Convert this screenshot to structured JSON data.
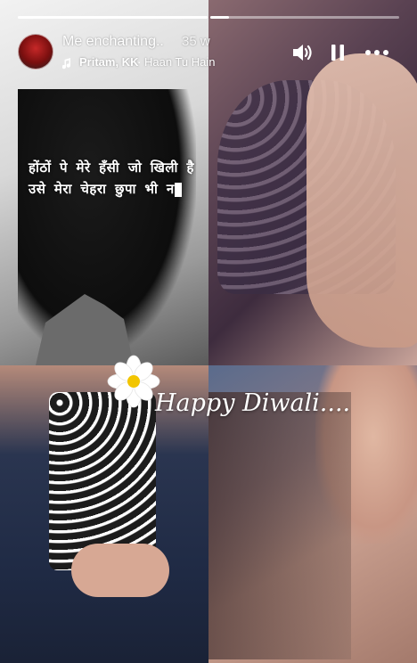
{
  "story": {
    "progress_segments": [
      1.0,
      0.1
    ],
    "account_title": "Me enchanting..",
    "time_ago": "35 w",
    "music": {
      "artist": "Pritam, KK",
      "separator": "·",
      "song": "Haan Tu Hain"
    },
    "controls": {
      "sound_icon": "speaker-icon",
      "pause_icon": "pause-icon",
      "more_icon": "more-icon"
    },
    "overlay_text_line1": "होंठों पे मेरे हँसी जो खिली है",
    "overlay_text_line2": "उसे मेरा चेहरा छुपा भी न",
    "greeting": "Happy Diwali...."
  }
}
